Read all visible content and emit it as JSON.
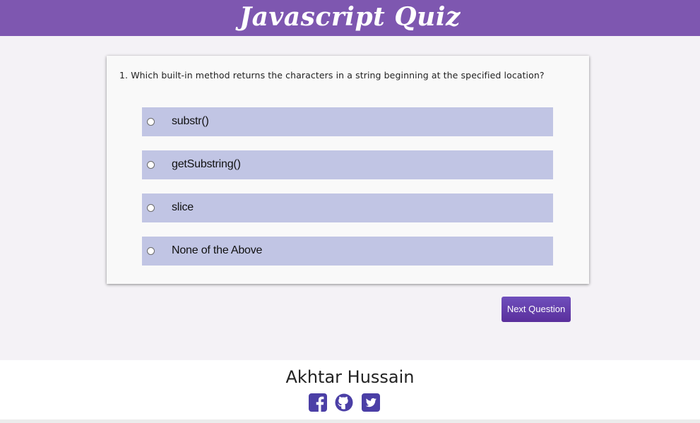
{
  "header": {
    "title": "Javascript Quiz"
  },
  "quiz": {
    "question": "1. Which built-in method returns the characters in a string beginning at the specified location?",
    "options": [
      {
        "label": "substr()"
      },
      {
        "label": "getSubstring()"
      },
      {
        "label": "slice"
      },
      {
        "label": "None of the Above"
      }
    ],
    "next_label": "Next Question"
  },
  "footer": {
    "name": "Akhtar Hussain",
    "social": [
      {
        "icon": "facebook-icon"
      },
      {
        "icon": "github-icon"
      },
      {
        "icon": "twitter-icon"
      }
    ]
  },
  "colors": {
    "header_bg": "#7e57b0",
    "option_bg": "#c1c5e4",
    "button_bg": "#5a2f9c",
    "social_icon": "#4b3fa6"
  }
}
